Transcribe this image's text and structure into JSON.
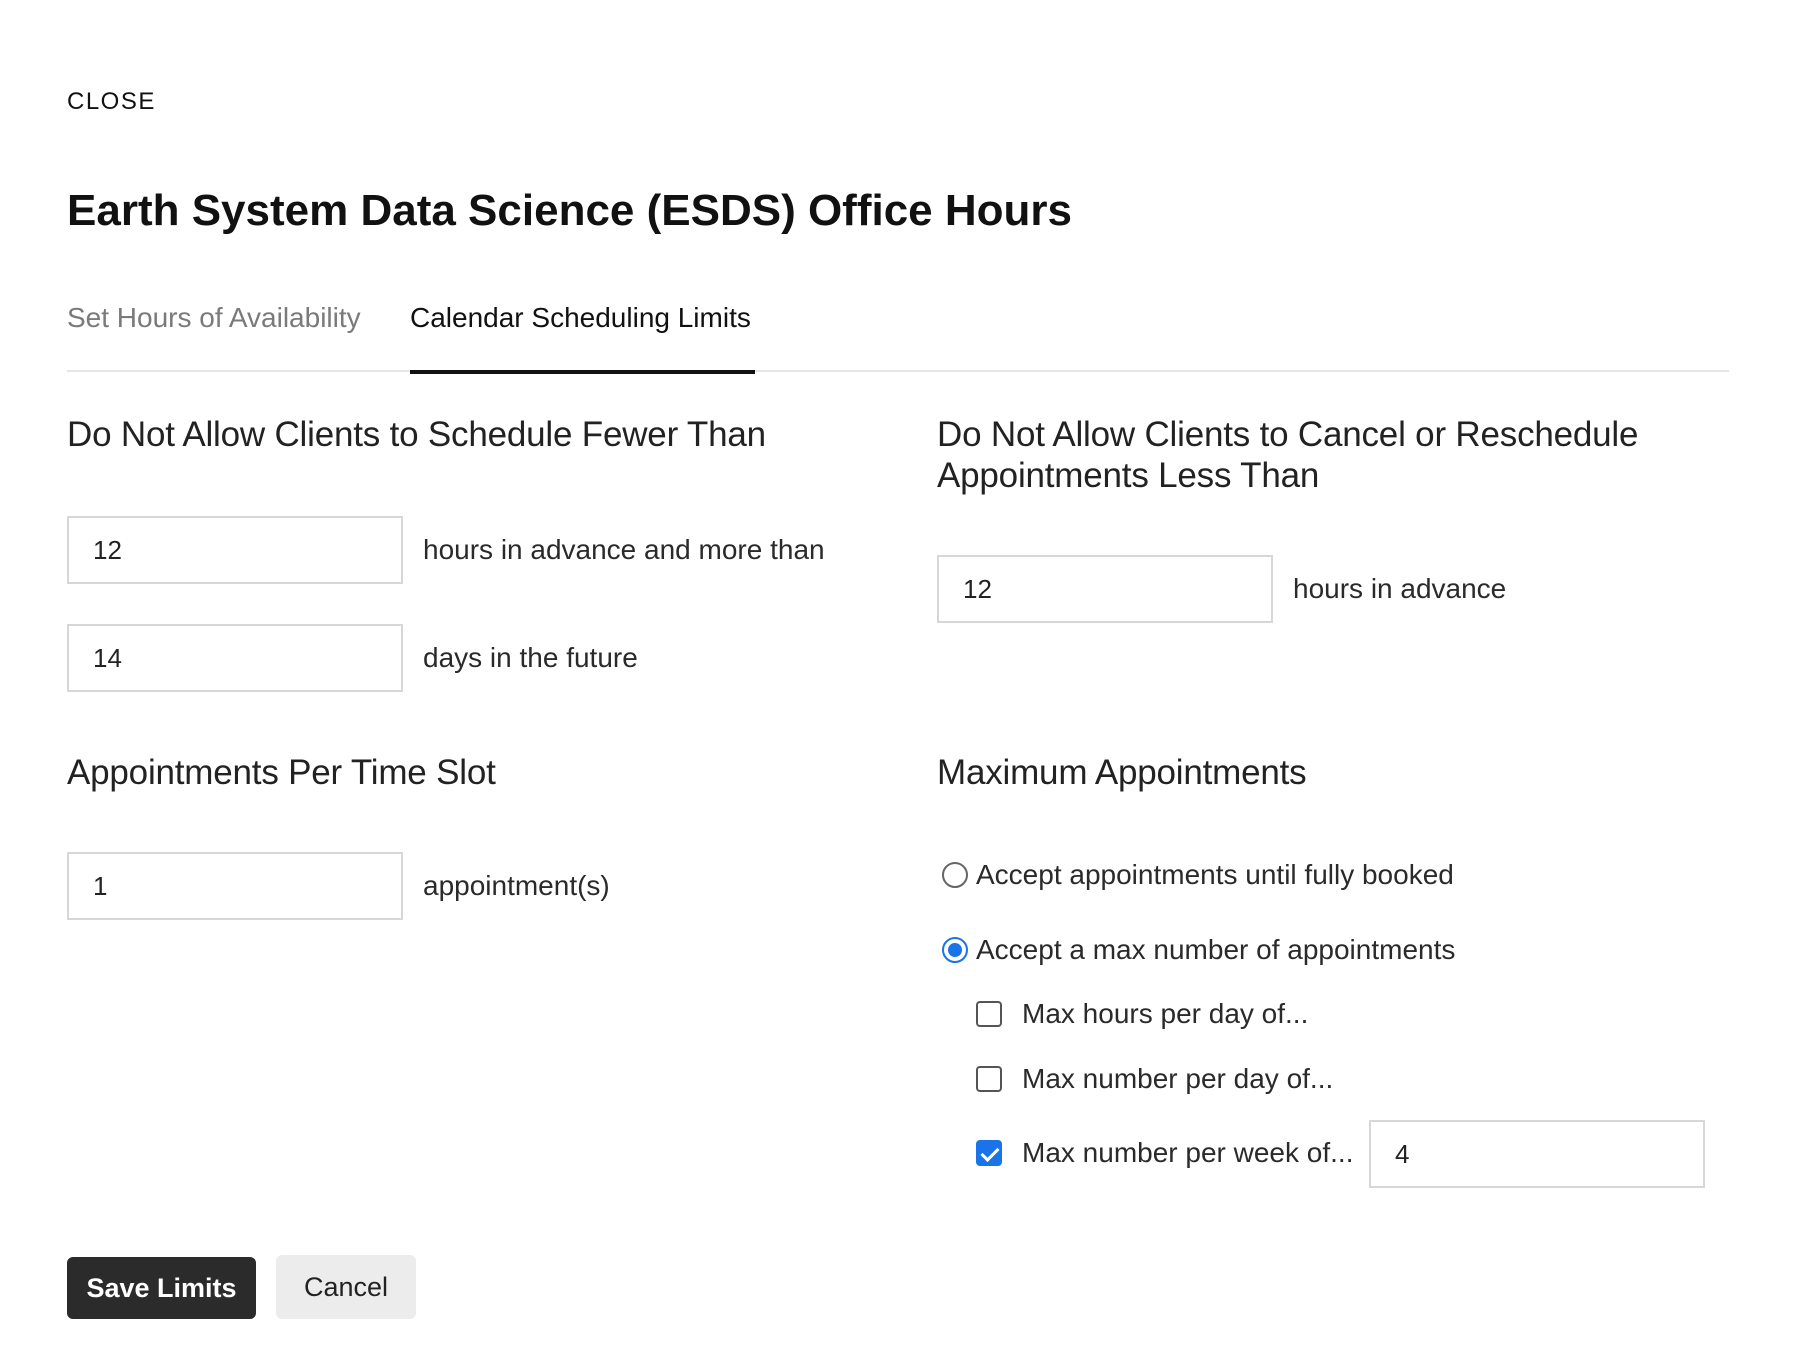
{
  "dialog": {
    "close_label": "CLOSE",
    "title": "Earth System Data Science (ESDS) Office Hours"
  },
  "tabs": [
    {
      "label": "Set Hours of Availability",
      "active": false
    },
    {
      "label": "Calendar Scheduling Limits",
      "active": true
    }
  ],
  "schedule_limits": {
    "heading": "Do Not Allow Clients to Schedule Fewer Than",
    "hours_value": "12",
    "hours_suffix": "hours in advance and more than",
    "days_value": "14",
    "days_suffix": "days in the future"
  },
  "cancel_limits": {
    "heading_line1": "Do Not Allow Clients to Cancel or Reschedule",
    "heading_line2": "Appointments Less Than",
    "hours_value": "12",
    "hours_suffix": "hours in advance"
  },
  "per_slot": {
    "heading": "Appointments Per Time Slot",
    "value": "1",
    "suffix": "appointment(s)"
  },
  "maximum": {
    "heading": "Maximum Appointments",
    "options": [
      {
        "label": "Accept appointments until fully booked",
        "selected": false
      },
      {
        "label": "Accept a max number of appointments",
        "selected": true
      }
    ],
    "limits": [
      {
        "label": "Max hours per day of...",
        "checked": false
      },
      {
        "label": "Max number per day of...",
        "checked": false
      },
      {
        "label": "Max number per week of...",
        "checked": true,
        "value": "4"
      }
    ]
  },
  "actions": {
    "save_label": "Save Limits",
    "cancel_label": "Cancel"
  },
  "colors": {
    "accent": "#1a73e8",
    "primary_button": "#2b2b2b",
    "secondary_button": "#ececec"
  }
}
